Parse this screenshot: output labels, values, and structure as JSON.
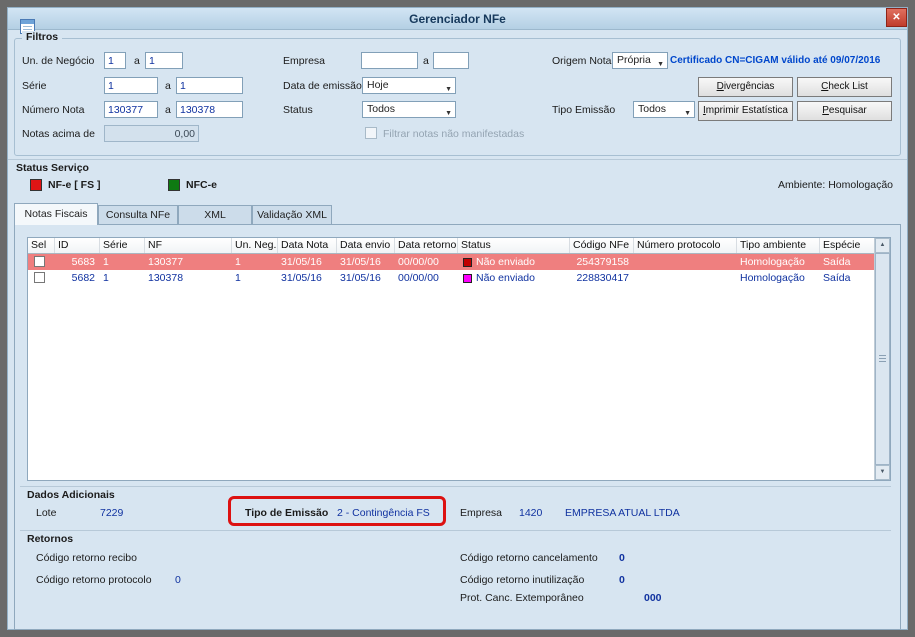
{
  "window": {
    "title": "Gerenciador NFe",
    "close_glyph": "✕"
  },
  "colors": {
    "value_text": "#1032a0",
    "certificate": "#0047cc",
    "highlight_row": "#ef7f7f",
    "nfe_status": "#e01515",
    "nfce_status": "#0e7a12",
    "annotation_red": "#dd1111"
  },
  "filters": {
    "title": "Filtros",
    "range_sep": "a",
    "un_negocio": {
      "label": "Un. de Negócio",
      "from": "1",
      "to": "1"
    },
    "serie": {
      "label": "Série",
      "from": "1",
      "to": "1"
    },
    "numero_nota": {
      "label": "Número Nota",
      "from": "130377",
      "to": "130378"
    },
    "notas_acima": {
      "label": "Notas acima de",
      "value": "0,00"
    },
    "empresa": {
      "label": "Empresa",
      "from": "",
      "to": ""
    },
    "data_emissao": {
      "label": "Data de emissão",
      "value": "Hoje"
    },
    "status": {
      "label": "Status",
      "value": "Todos"
    },
    "origem_nota": {
      "label": "Origem Nota",
      "value": "Própria"
    },
    "tipo_emissao": {
      "label": "Tipo Emissão",
      "value": "Todos"
    },
    "certificate": "Certificado CN=CIGAM válido até 09/07/2016",
    "manifest_checkbox": "Filtrar notas não manifestadas",
    "buttons": {
      "divergencias": "Divergências",
      "check_list": "Check List",
      "imprimir": "Imprimir Estatística",
      "pesquisar": "Pesquisar"
    }
  },
  "status_servico": {
    "title": "Status Serviço",
    "nfe_label": "NF-e  [ FS ]",
    "nfce_label": "NFC-e",
    "ambiente": "Ambiente: Homologação"
  },
  "tabs": [
    {
      "label": "Notas Fiscais",
      "active": true
    },
    {
      "label": "Consulta NFe",
      "active": false
    },
    {
      "label": "XML",
      "active": false
    },
    {
      "label": "Validação XML",
      "active": false
    }
  ],
  "table": {
    "headers": [
      "Sel",
      "ID",
      "Série",
      "NF",
      "Un. Neg.",
      "Data Nota",
      "Data envio",
      "Data retorno",
      "Status",
      "Código NFe",
      "Número protocolo",
      "Tipo ambiente",
      "Espécie"
    ],
    "rows": [
      {
        "id": "5683",
        "serie": "1",
        "nf": "130377",
        "un_neg": "1",
        "data_nota": "31/05/16",
        "data_envio": "31/05/16",
        "data_retorno": "00/00/00",
        "status": "Não enviado",
        "status_color": "#c00000",
        "codigo_nfe": "254379158",
        "protocolo": "",
        "ambiente": "Homologação",
        "especie": "Saída",
        "highlighted": true
      },
      {
        "id": "5682",
        "serie": "1",
        "nf": "130378",
        "un_neg": "1",
        "data_nota": "31/05/16",
        "data_envio": "31/05/16",
        "data_retorno": "00/00/00",
        "status": "Não enviado",
        "status_color": "#ff00ff",
        "codigo_nfe": "228830417",
        "protocolo": "",
        "ambiente": "Homologação",
        "especie": "Saída",
        "highlighted": false
      }
    ]
  },
  "dados": {
    "title": "Dados Adicionais",
    "lote_label": "Lote",
    "lote": "7229",
    "tipo_label": "Tipo de Emissão",
    "tipo_valor": "2 - Contingência FS",
    "empresa_label": "Empresa",
    "empresa_codigo": "1420",
    "empresa_nome": "EMPRESA ATUAL LTDA"
  },
  "retornos": {
    "title": "Retornos",
    "recibo_label": "Código retorno recibo",
    "recibo": "",
    "protocolo_label": "Código retorno protocolo",
    "protocolo": "0",
    "cancelamento_label": "Código retorno cancelamento",
    "cancelamento": "0",
    "inutilizacao_label": "Código retorno inutilização",
    "inutilizacao": "0",
    "prot_canc_label": "Prot. Canc. Extemporâneo",
    "prot_canc": "000"
  }
}
